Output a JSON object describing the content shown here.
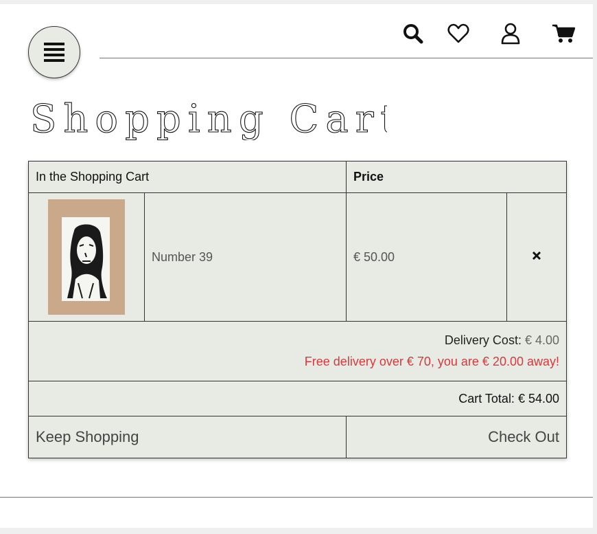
{
  "header": {
    "menu_icon": "hamburger-icon",
    "nav_icons": [
      "search-icon",
      "heart-icon",
      "user-icon",
      "cart-icon"
    ]
  },
  "page_title": "Shopping Cart",
  "cart": {
    "headers": {
      "item": "In the Shopping Cart",
      "price": "Price"
    },
    "items": [
      {
        "name": "Number 39",
        "price": "€ 50.00",
        "remove_icon": "close-icon"
      }
    ],
    "delivery": {
      "label": "Delivery Cost:",
      "value": "€ 4.00",
      "free_prefix": "Free delivery over € 70",
      "free_middle": ", you are ",
      "free_amount": "€ 20.00",
      "free_suffix": " away!"
    },
    "total": {
      "label": "Cart Total:",
      "value": "€ 54.00"
    },
    "actions": {
      "keep_shopping": "Keep Shopping",
      "check_out": "Check Out"
    }
  },
  "colors": {
    "table_bg": "#e8ebe4",
    "accent_red": "#d9383c"
  }
}
